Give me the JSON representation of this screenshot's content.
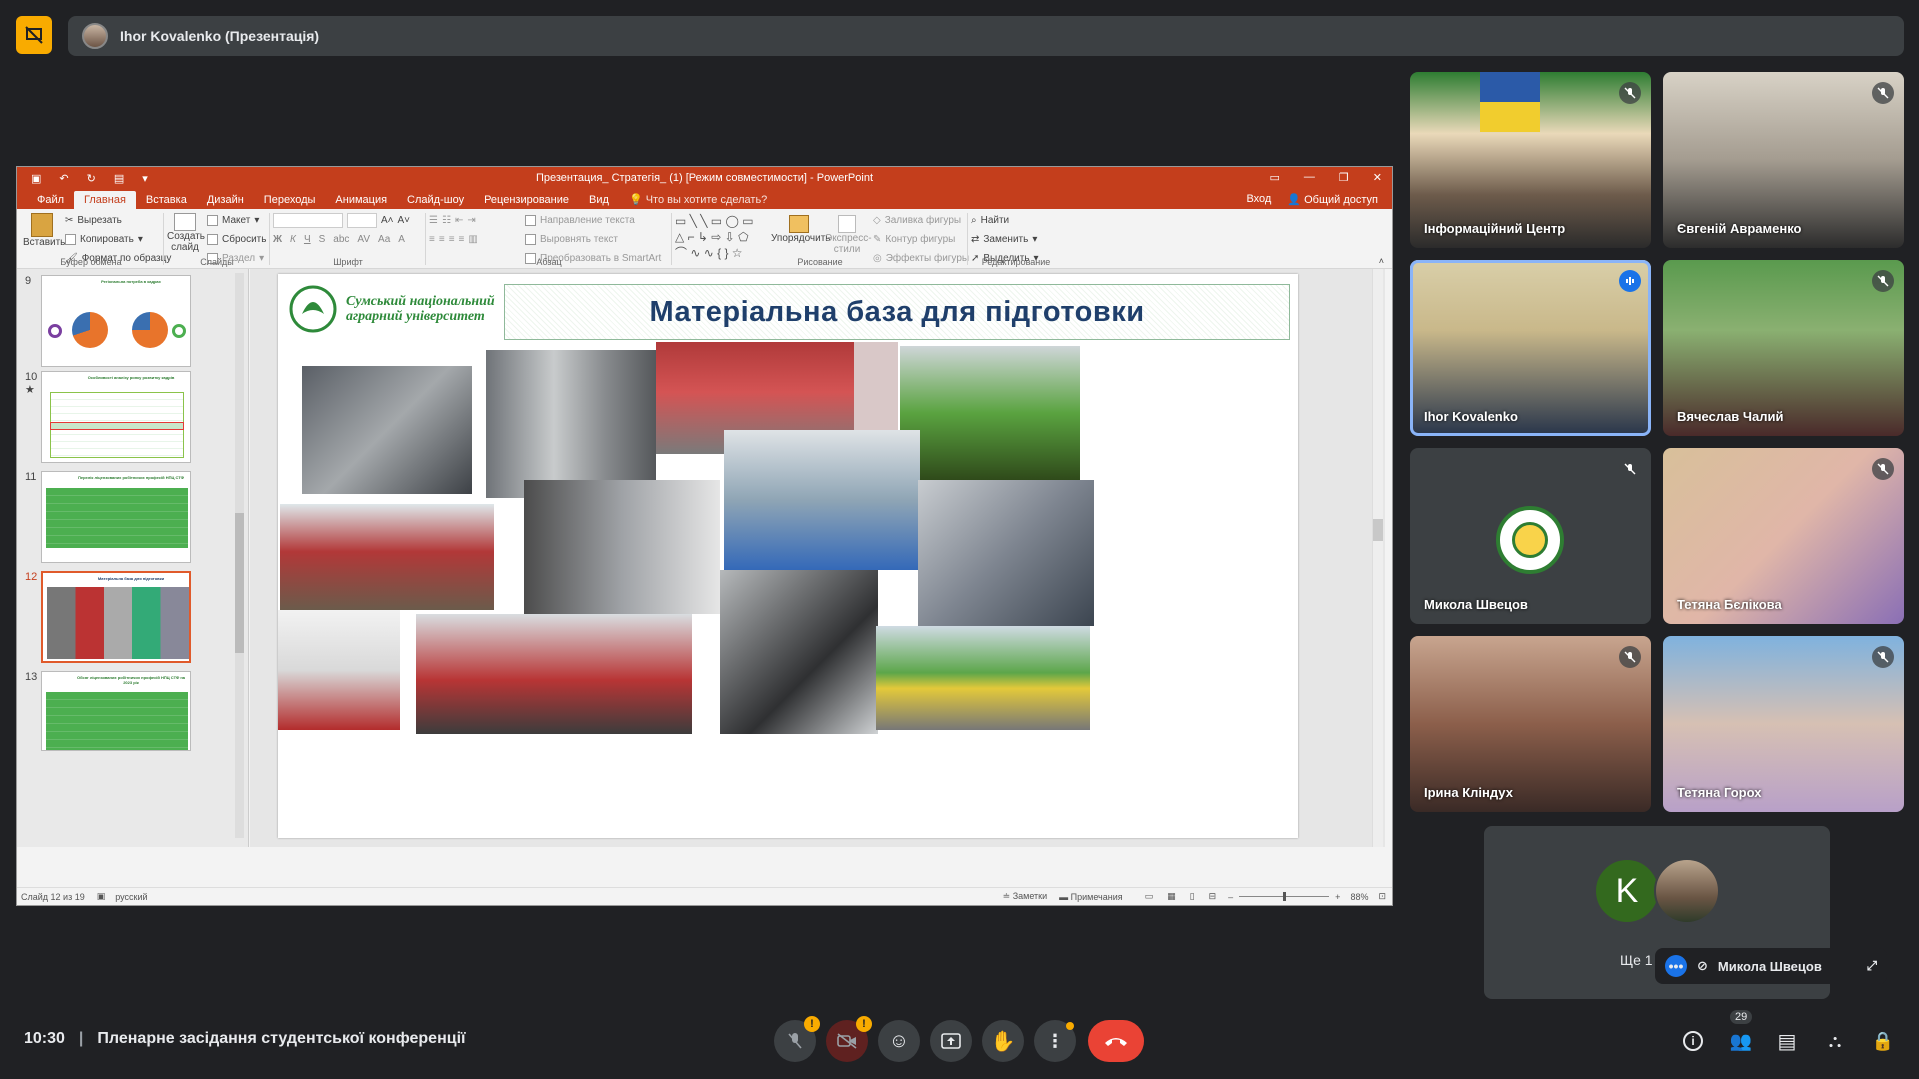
{
  "presenter_bar": {
    "title": "Ihor Kovalenko (Презентація)"
  },
  "ppt": {
    "window_title": "Презентация_ Стратегія_ (1) [Режим совместимости] - PowerPoint",
    "tabs": [
      "Файл",
      "Главная",
      "Вставка",
      "Дизайн",
      "Переходы",
      "Анимация",
      "Слайд-шоу",
      "Рецензирование",
      "Вид"
    ],
    "tell_me": "Что вы хотите сделать?",
    "sign_in": "Вход",
    "share": "Общий доступ",
    "ribbon": {
      "paste": "Вставить",
      "cut": "Вырезать",
      "copy": "Копировать",
      "format_painter": "Формат по образцу",
      "clipboard": "Буфер обмена",
      "new_slide": "Создать слайд",
      "layout": "Макет",
      "reset": "Сбросить",
      "section": "Раздел",
      "slides": "Слайды",
      "font": "Шрифт",
      "text_direction": "Направление текста",
      "align_text": "Выровнять текст",
      "smartart": "Преобразовать в SmartArt",
      "paragraph": "Абзац",
      "arrange": "Упорядочить",
      "quick_styles": "Экспресс-стили",
      "shape_fill": "Заливка фигуры",
      "shape_outline": "Контур фигуры",
      "shape_effects": "Эффекты фигуры",
      "drawing": "Рисование",
      "find": "Найти",
      "replace": "Заменить",
      "select": "Выделить",
      "editing": "Редактирование"
    },
    "thumbnails": [
      {
        "num": "9",
        "title": "Регіональна потреба в кадрах"
      },
      {
        "num": "10",
        "title": "Особливості аналізу ринку розвитку кадрів"
      },
      {
        "num": "11",
        "title": "Перелік ліцензованих робітничих професій НПЦ СТФ"
      },
      {
        "num": "12",
        "title": "Матеріальна база для підготовки"
      },
      {
        "num": "13",
        "title": "Обсяг ліцензованих робітничих професій НПЦ СТФ на 2023 рік"
      }
    ],
    "slide": {
      "logo_line1": "Сумський національний",
      "logo_line2": "аграрний університет",
      "title": "Матеріальна база для підготовки"
    },
    "status": {
      "slide_of": "Слайд 12 из 19",
      "lang": "русский",
      "notes": "Заметки",
      "comments": "Примечания",
      "zoom": "88%"
    }
  },
  "participants": [
    {
      "name": "Інформаційний Центр",
      "muted": true
    },
    {
      "name": "Євгеній Авраменко",
      "muted": true
    },
    {
      "name": "Ihor Kovalenko",
      "muted": false,
      "speaking": true
    },
    {
      "name": "Вячеслав Чалий",
      "muted": true
    },
    {
      "name": "Микола Швецов",
      "muted": true
    },
    {
      "name": "Тетяна Бєлікова",
      "muted": true
    },
    {
      "name": "Ірина Кліндух",
      "muted": true
    },
    {
      "name": "Тетяна Горох",
      "muted": true
    }
  ],
  "more_tile": {
    "avatar_letter": "K",
    "more_text": "Ще 1",
    "pill_name": "Микола Швецов"
  },
  "bottom": {
    "time": "10:30",
    "divider": "|",
    "meeting_title": "Пленарне засідання студентської конференції",
    "participants_count": "29",
    "alert_badge": "!"
  }
}
